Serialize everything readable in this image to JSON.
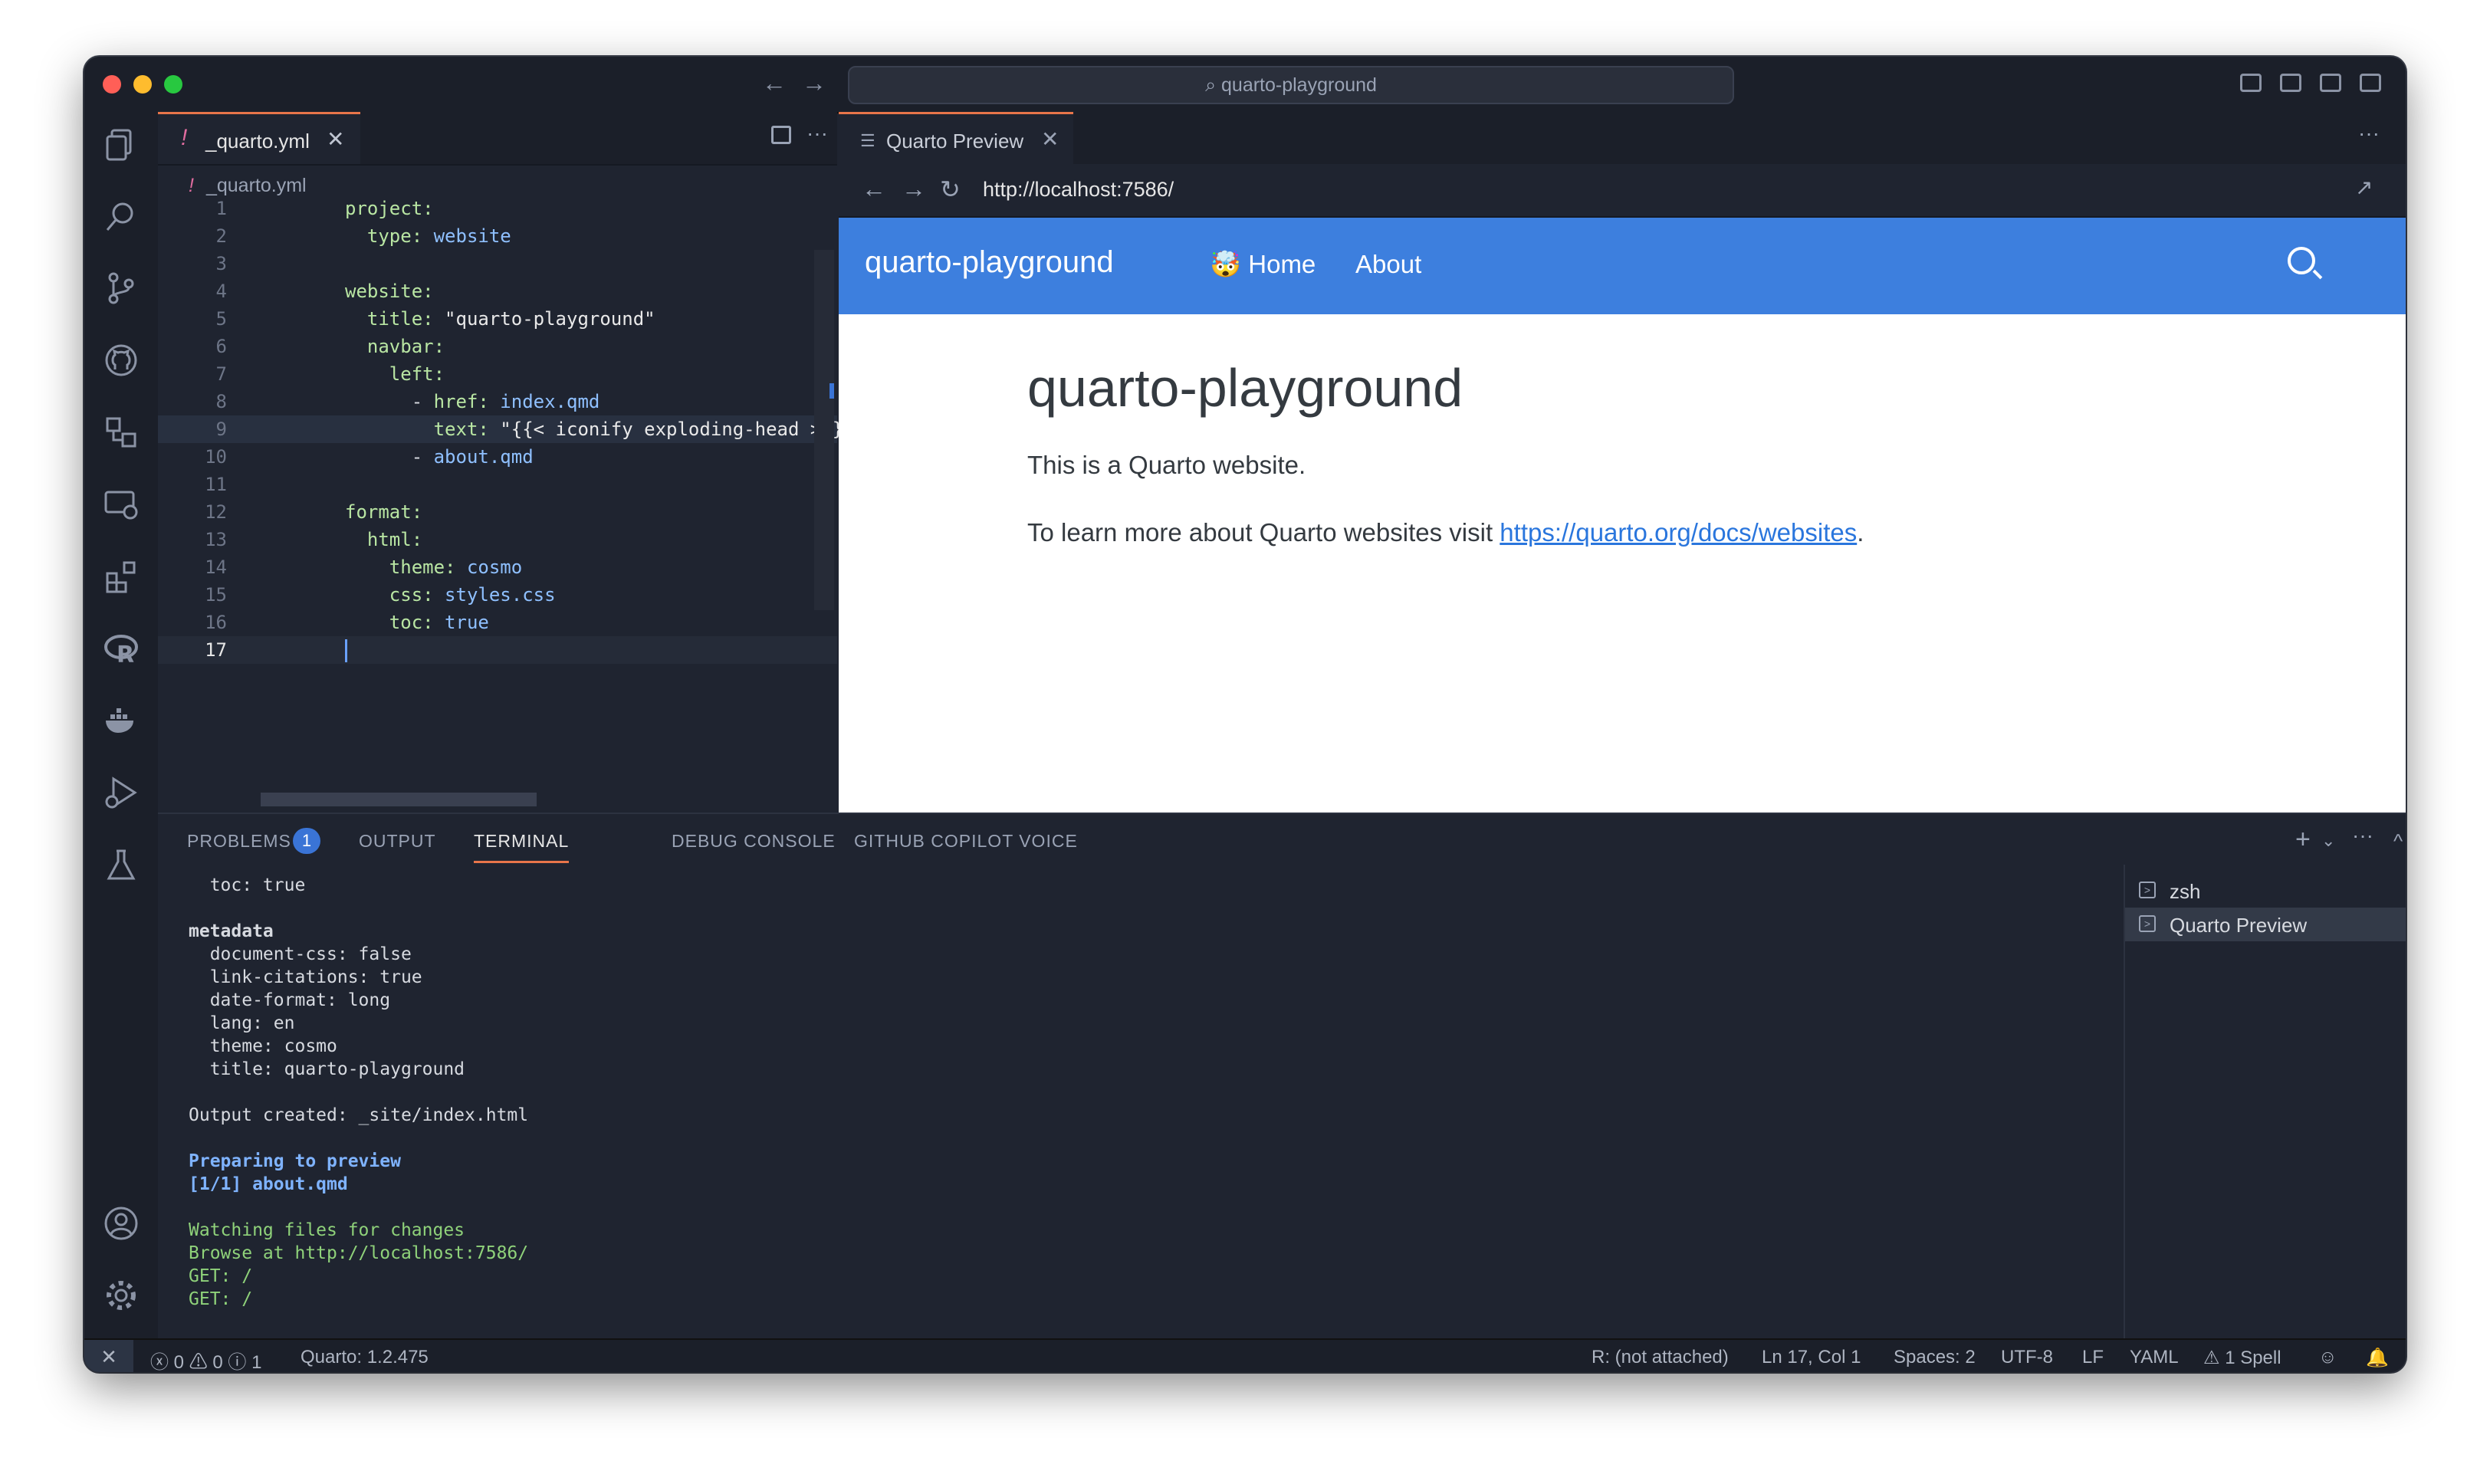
{
  "window": {
    "command_center": "quarto-playground"
  },
  "editor": {
    "tab_label": "_quarto.yml",
    "breadcrumb": "_quarto.yml",
    "lines": [
      {
        "n": "1",
        "indent": "",
        "key": "project:",
        "val": ""
      },
      {
        "n": "2",
        "indent": "  ",
        "key": "type:",
        "val": " website"
      },
      {
        "n": "3",
        "indent": "",
        "key": "",
        "val": ""
      },
      {
        "n": "4",
        "indent": "",
        "key": "website:",
        "val": ""
      },
      {
        "n": "5",
        "indent": "  ",
        "key": "title:",
        "val": " \"quarto-playground\""
      },
      {
        "n": "6",
        "indent": "  ",
        "key": "navbar:",
        "val": ""
      },
      {
        "n": "7",
        "indent": "    ",
        "key": "left:",
        "val": ""
      },
      {
        "n": "8",
        "indent": "      - ",
        "key": "href:",
        "val": " index.qmd"
      },
      {
        "n": "9",
        "indent": "        ",
        "key": "text:",
        "val": " \"{{< iconify exploding-head >}} Home\""
      },
      {
        "n": "10",
        "indent": "      - ",
        "key": "",
        "val": "about.qmd"
      },
      {
        "n": "11",
        "indent": "",
        "key": "",
        "val": ""
      },
      {
        "n": "12",
        "indent": "",
        "key": "format:",
        "val": ""
      },
      {
        "n": "13",
        "indent": "  ",
        "key": "html:",
        "val": ""
      },
      {
        "n": "14",
        "indent": "    ",
        "key": "theme:",
        "val": " cosmo"
      },
      {
        "n": "15",
        "indent": "    ",
        "key": "css:",
        "val": " styles.css"
      },
      {
        "n": "16",
        "indent": "    ",
        "key": "toc:",
        "val": " true"
      },
      {
        "n": "17",
        "indent": "",
        "key": "",
        "val": ""
      }
    ]
  },
  "preview": {
    "tab_label": "Quarto Preview",
    "url": "http://localhost:7586/",
    "brand": "quarto-playground",
    "nav_home": "🤯 Home",
    "nav_about": "About",
    "heading": "quarto-playground",
    "paragraph1": "This is a Quarto website.",
    "paragraph2_prefix": "To learn more about Quarto websites visit ",
    "paragraph2_link": "https://quarto.org/docs/websites",
    "paragraph2_suffix": "."
  },
  "panel": {
    "tabs": [
      "PROBLEMS",
      "OUTPUT",
      "TERMINAL",
      "DEBUG CONSOLE",
      "GITHUB COPILOT VOICE"
    ],
    "problems_count": "1",
    "terminal_lines": [
      {
        "text": "  toc: true",
        "style": ""
      },
      {
        "text": "",
        "style": ""
      },
      {
        "text": "metadata",
        "style": "bold"
      },
      {
        "text": "  document-css: false",
        "style": ""
      },
      {
        "text": "  link-citations: true",
        "style": ""
      },
      {
        "text": "  date-format: long",
        "style": ""
      },
      {
        "text": "  lang: en",
        "style": ""
      },
      {
        "text": "  theme: cosmo",
        "style": ""
      },
      {
        "text": "  title: quarto-playground",
        "style": ""
      },
      {
        "text": "",
        "style": ""
      },
      {
        "text": "Output created: _site/index.html",
        "style": ""
      },
      {
        "text": "",
        "style": ""
      },
      {
        "text": "Preparing to preview",
        "style": "blue"
      },
      {
        "text": "[1/1] about.qmd",
        "style": "blue"
      },
      {
        "text": "",
        "style": ""
      },
      {
        "text": "Watching files for changes",
        "style": "green"
      },
      {
        "text": "Browse at http://localhost:7586/",
        "style": "green"
      },
      {
        "text": "GET: /",
        "style": "green"
      },
      {
        "text": "GET: /",
        "style": "green"
      }
    ],
    "terminals": [
      "zsh",
      "Quarto Preview"
    ]
  },
  "status": {
    "errors": "0",
    "warnings": "0",
    "info": "1",
    "quarto": "Quarto: 1.2.475",
    "r": "R: (not attached)",
    "position": "Ln 17, Col 1",
    "spaces": "Spaces: 2",
    "encoding": "UTF-8",
    "eol": "LF",
    "language": "YAML",
    "spell": "1 Spell"
  },
  "icons": [
    "files-icon",
    "search-icon",
    "source-control-icon",
    "github-icon",
    "remote-explorer-icon",
    "remote-window-icon",
    "extensions-icon",
    "r-icon",
    "docker-icon",
    "run-debug-icon",
    "testing-icon",
    "account-icon",
    "settings-gear-icon"
  ],
  "colors": {
    "accent": "#e8754a",
    "navbar": "#3d7fde",
    "link": "#2a76dd"
  }
}
